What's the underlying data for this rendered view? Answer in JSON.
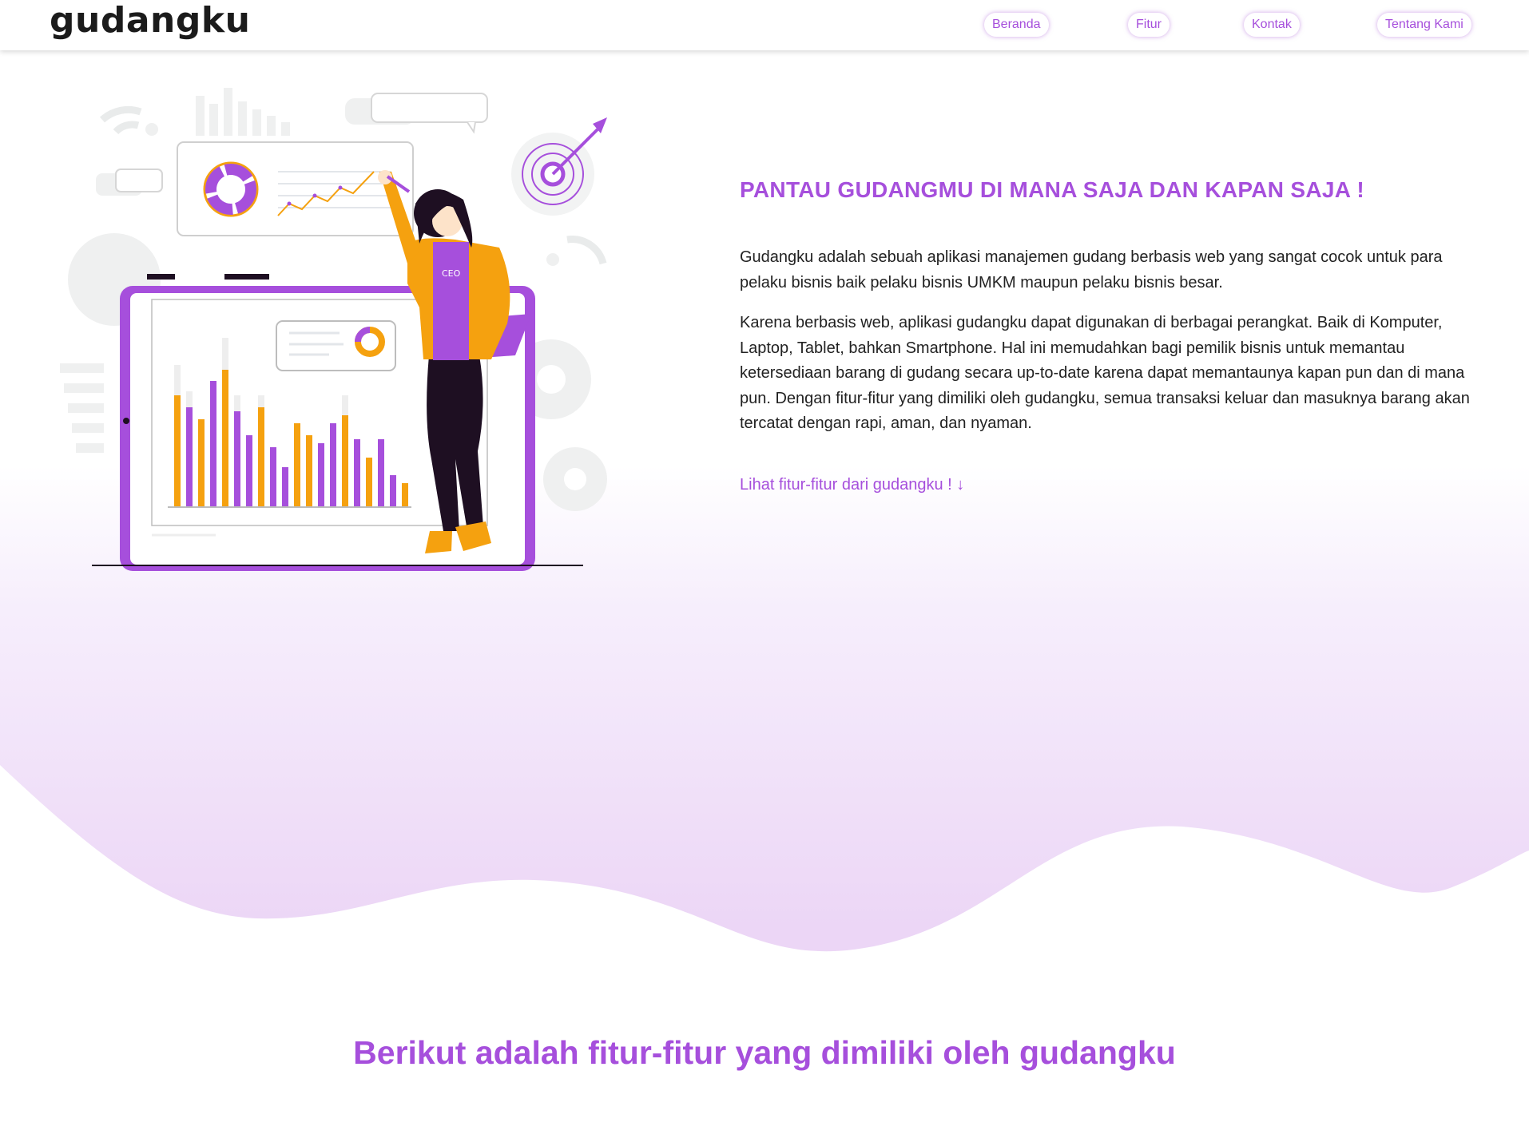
{
  "brand": "gudangku",
  "nav": {
    "items": [
      "Beranda",
      "Fitur",
      "Kontak",
      "Tentang Kami"
    ]
  },
  "hero": {
    "title": "PANTAU GUDANGMU DI MANA SAJA DAN KAPAN SAJA !",
    "paragraph1": "Gudangku adalah sebuah aplikasi manajemen gudang berbasis web yang sangat cocok untuk para pelaku bisnis baik pelaku bisnis UMKM maupun pelaku bisnis besar.",
    "paragraph2": "Karena berbasis web, aplikasi gudangku dapat digunakan di berbagai perangkat. Baik di Komputer, Laptop, Tablet, bahkan Smartphone. Hal ini memudahkan bagi pemilik bisnis untuk memantau ketersediaan barang di gudang secara up-to-date karena dapat memantaunya kapan pun dan di mana pun. Dengan fitur-fitur yang dimiliki oleh gudangku, semua transaksi keluar dan masuknya barang akan tercatat dengan rapi, aman, dan nyaman.",
    "link": "Lihat fitur-fitur dari gudangku ! ↓",
    "illustration_shirt_text": "CEO"
  },
  "features": {
    "title": "Berikut adalah fitur-fitur yang dimiliki oleh gudangku"
  },
  "colors": {
    "accent": "#a64fdc",
    "orange": "#f5a10f",
    "dark": "#1e0f22"
  }
}
